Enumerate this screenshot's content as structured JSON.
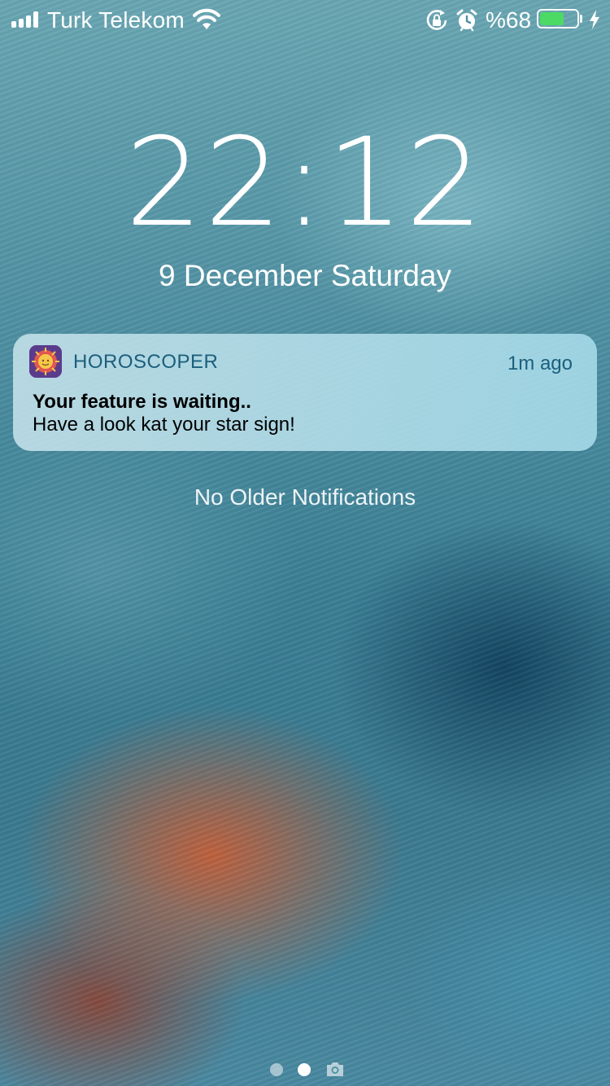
{
  "status_bar": {
    "carrier": "Turk Telekom",
    "battery_percent": "%68",
    "battery_level": 0.68,
    "signal_icon": "signal-bars-icon",
    "wifi_icon": "wifi-icon",
    "rotation_lock_icon": "rotation-lock-icon",
    "alarm_icon": "alarm-icon",
    "charging_icon": "lightning-bolt-icon",
    "battery_color": "#4cd964"
  },
  "lock_screen": {
    "time": "22:12",
    "date": "9 December Saturday"
  },
  "notification": {
    "app_name": "HOROSCOPER",
    "time_ago": "1m ago",
    "title": "Your feature is waiting..",
    "body": "Have a look kat your star sign!",
    "app_icon": "horoscope-sun-icon",
    "accent_color": "#1b5f7d"
  },
  "no_older_notifications": "No Older Notifications",
  "page_indicator": {
    "pages": 2,
    "current_page": 2,
    "camera_icon": "camera-icon"
  }
}
